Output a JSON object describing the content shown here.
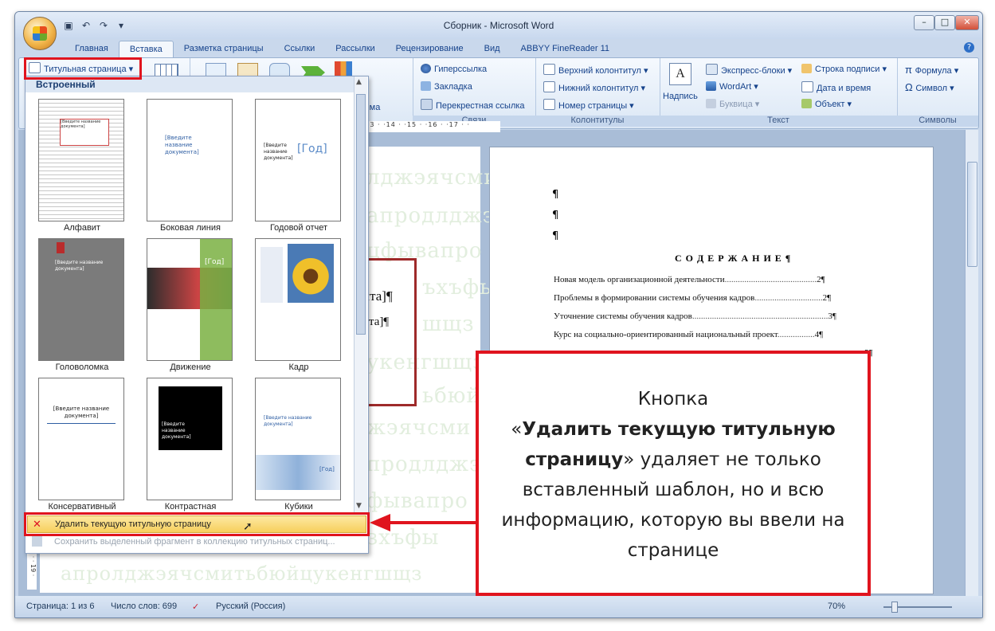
{
  "window": {
    "title": "Сборник - Microsoft Word",
    "controls": {
      "minimize": "–",
      "maximize": "□",
      "close": "✕"
    }
  },
  "quick_access": {
    "items": [
      "save-icon",
      "undo-icon",
      "redo-icon",
      "customize-icon"
    ]
  },
  "tabs": [
    "Главная",
    "Вставка",
    "Разметка страницы",
    "Ссылки",
    "Рассылки",
    "Рецензирование",
    "Вид",
    "ABBYY FineReader 11"
  ],
  "active_tab": "Вставка",
  "ribbon": {
    "cover_page_button": "Титульная страница",
    "chart_partial": "амма",
    "links_group": {
      "label": "Связи",
      "items": [
        "Гиперссылка",
        "Закладка",
        "Перекрестная ссылка"
      ]
    },
    "headers_group": {
      "label": "Колонтитулы",
      "items": [
        "Верхний колонтитул",
        "Нижний колонтитул",
        "Номер страницы"
      ]
    },
    "text_group": {
      "label": "Текст",
      "textbox": "Надпись",
      "items": [
        "Экспресс-блоки",
        "WordArt",
        "Буквица",
        "Строка подписи",
        "Дата и время",
        "Объект"
      ]
    },
    "symbols_group": {
      "label": "Символы",
      "items": [
        "Формула",
        "Символ"
      ]
    }
  },
  "ruler_text": "2 · ·13 · ·14 · ·15 · ·16 · ·17 · ·",
  "gallery": {
    "header": "Встроенный",
    "templates": [
      {
        "name": "Алфавит"
      },
      {
        "name": "Боковая линия"
      },
      {
        "name": "Годовой отчет"
      },
      {
        "name": "Головоломка"
      },
      {
        "name": "Движение"
      },
      {
        "name": "Кадр"
      },
      {
        "name": "Консервативный"
      },
      {
        "name": "Контрастная"
      },
      {
        "name": "Кубики"
      }
    ],
    "thumb_text": {
      "enter_title": "[Введите название документа]",
      "year": "[Год]"
    },
    "delete_item": "Удалить текущую титульную страницу",
    "save_item": "Сохранить выделенный фрагмент в коллекцию титульных страниц..."
  },
  "document": {
    "left_page": {
      "ghost_lines": [
        "лджэячсми",
        "апродлджэ",
        "цфывапро",
        "ъхъфы",
        "шщз",
        "ьбюй",
        "укенгшщз",
        "жэячсми",
        "продлджэ",
        "фывапро",
        "зхъфы",
        "апролджэячсмитьбюйцукенгшщз"
      ],
      "bracket_1": "нта]¶",
      "bracket_2": "нта]¶"
    },
    "right_page": {
      "pilcrows": [
        "¶",
        "¶",
        "¶"
      ],
      "toc_title": "С О Д Е Р Ж А Н И Е ¶",
      "toc": [
        {
          "text": "Новая модель организационной деятельности",
          "page": "2¶"
        },
        {
          "text": "Проблемы в формировании системы обучения кадров",
          "page": "2¶"
        },
        {
          "text": "Уточнение системы обучения кадров",
          "page": "3¶"
        },
        {
          "text": "Курс на социально-ориентированный национальный проект",
          "page": "4¶"
        },
        {
          "text": "",
          "page": "5¶"
        }
      ]
    }
  },
  "vertical_ruler_text": "· 18 · · 19 ·",
  "status_bar": {
    "page": "Страница: 1 из 6",
    "words": "Число слов: 699",
    "language": "Русский (Россия)",
    "zoom": "70%"
  },
  "callout": {
    "line1": "Кнопка",
    "quote_open": "«",
    "bold": "Удалить текущую титульную страницу",
    "quote_close": "»",
    "rest": " удаляет не только вставленный шаблон, но и всю информацию, которую вы ввели на странице"
  },
  "colors": {
    "accent_red": "#e0141e",
    "ribbon_text": "#15428b",
    "highlight": "#f7cf5c"
  }
}
